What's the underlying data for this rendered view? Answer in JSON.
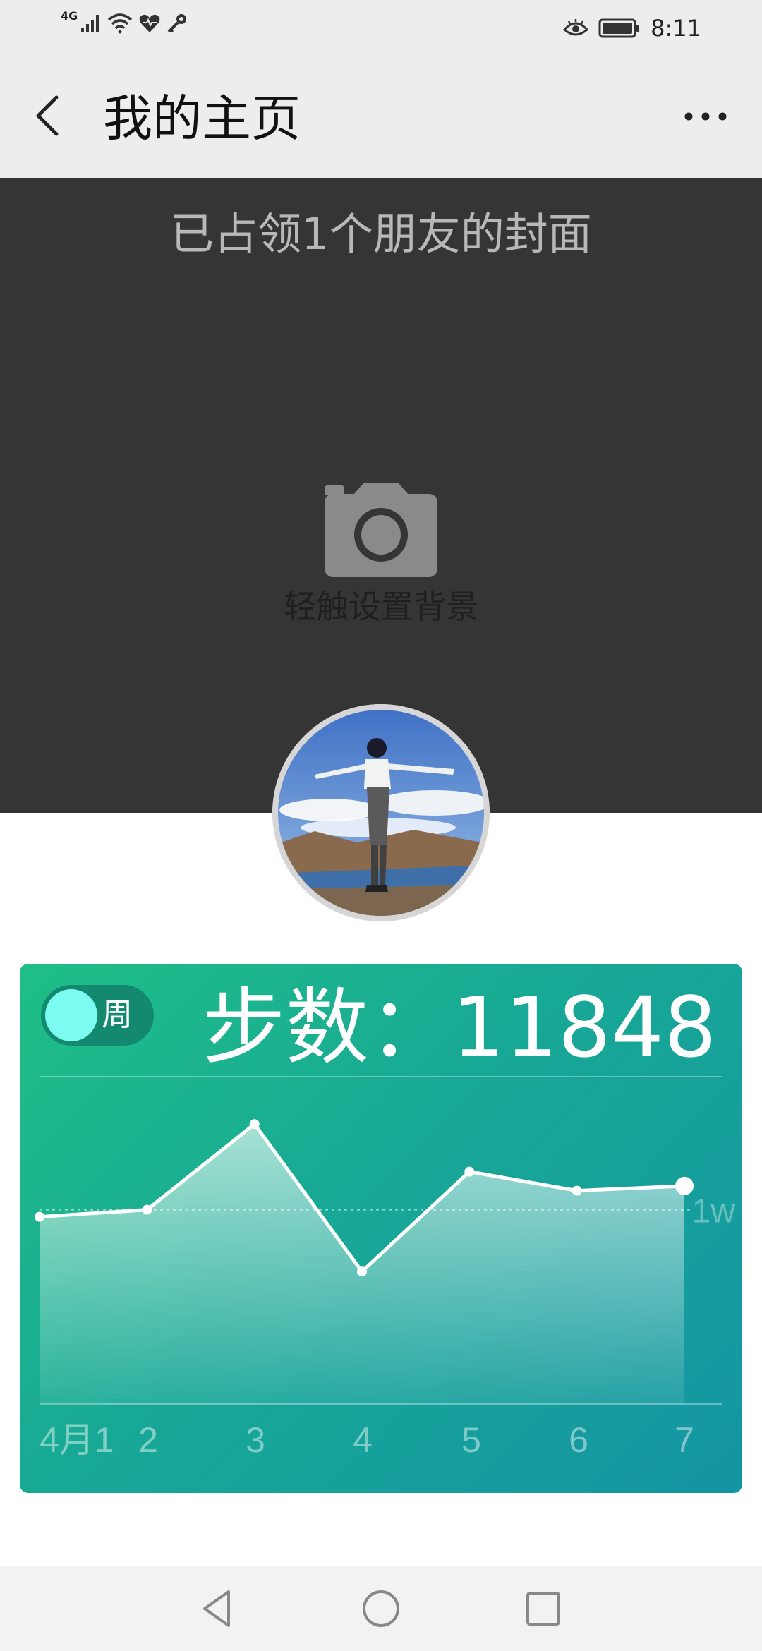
{
  "status_bar": {
    "network": "4G",
    "time": "8:11",
    "icons": [
      "signal-icon",
      "wifi-icon",
      "heart-icon",
      "key-icon",
      "eye-icon",
      "battery-icon"
    ]
  },
  "nav": {
    "title": "我的主页",
    "back_icon": "back-arrow-icon",
    "more_icon": "more-dots-icon"
  },
  "cover": {
    "caption": "已占领1个朋友的封面",
    "hint": "轻触设置背景",
    "camera_icon": "camera-icon"
  },
  "step_card": {
    "toggle_label": "周",
    "steps_text": "步数：11848",
    "colors": {
      "start": "#1fbf86",
      "end": "#1495a3",
      "toggle_knob": "#7cfbf0"
    }
  },
  "chart_data": {
    "type": "area",
    "x": [
      "4月1",
      "2",
      "3",
      "4",
      "5",
      "6",
      "7"
    ],
    "values": [
      8700,
      9000,
      12600,
      6400,
      10600,
      9800,
      10000
    ],
    "reference_line": {
      "label": "1w",
      "value": 9000
    },
    "ylim": [
      0,
      14000
    ],
    "grid": false,
    "line_color": "#ffffff"
  },
  "system_nav": {
    "icons": [
      "back-triangle-icon",
      "home-circle-icon",
      "recents-square-icon"
    ]
  }
}
